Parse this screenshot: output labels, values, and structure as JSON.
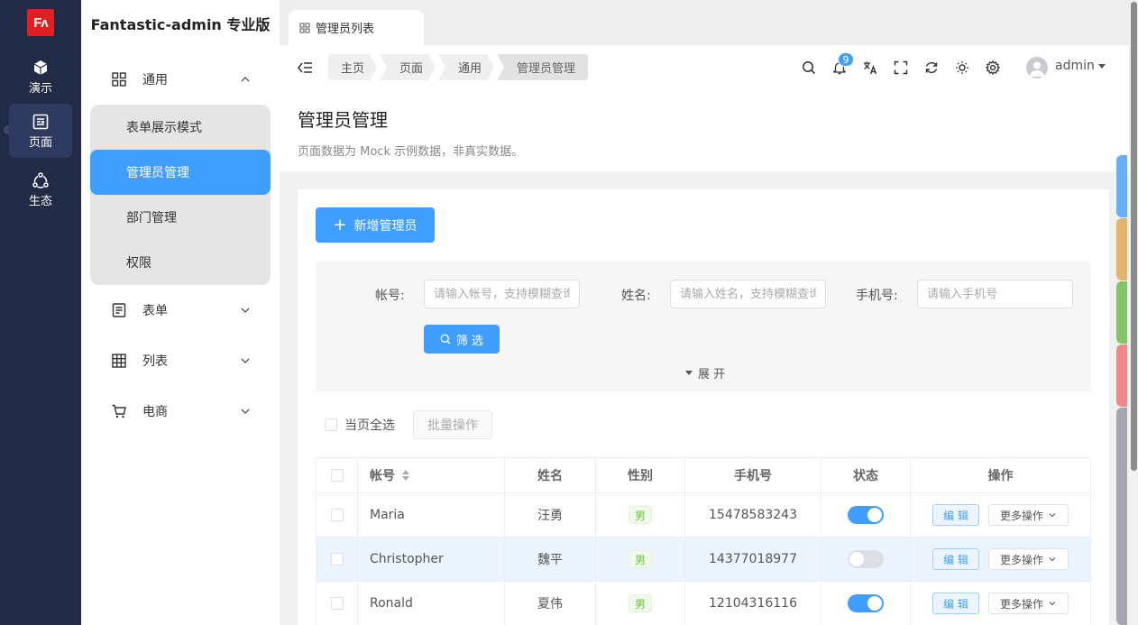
{
  "logo": {
    "text": "Fʌ"
  },
  "main_sidebar": {
    "items": [
      {
        "label": "演示",
        "icon": "cube-icon"
      },
      {
        "label": "页面",
        "icon": "page-icon"
      },
      {
        "label": "生态",
        "icon": "ecosystem-icon"
      }
    ]
  },
  "sub_sidebar": {
    "brand": "Fantastic-admin 专业版",
    "groups": [
      {
        "label": "通用",
        "icon": "grid-icon"
      },
      {
        "label": "表单",
        "icon": "form-icon"
      },
      {
        "label": "列表",
        "icon": "table-icon"
      },
      {
        "label": "电商",
        "icon": "cart-icon"
      }
    ],
    "sub_items": [
      {
        "label": "表单展示模式"
      },
      {
        "label": "管理员管理"
      },
      {
        "label": "部门管理"
      },
      {
        "label": "权限"
      }
    ]
  },
  "tabs": [
    {
      "label": "管理员列表"
    }
  ],
  "breadcrumb": [
    {
      "label": "主页"
    },
    {
      "label": "页面"
    },
    {
      "label": "通用"
    },
    {
      "label": "管理员管理"
    }
  ],
  "toolbar": {
    "notification_count": "9",
    "user_name": "admin"
  },
  "page": {
    "title": "管理员管理",
    "description": "页面数据为 Mock 示例数据，非真实数据。"
  },
  "actions": {
    "add_button": "新增管理员",
    "filter_button": "筛 选",
    "expand": "展 开",
    "select_page": "当页全选",
    "batch_button": "批量操作"
  },
  "search": {
    "fields": [
      {
        "label": "帐号:",
        "placeholder": "请输入帐号，支持模糊查询"
      },
      {
        "label": "姓名:",
        "placeholder": "请输入姓名，支持模糊查询"
      },
      {
        "label": "手机号:",
        "placeholder": "请输入手机号"
      }
    ]
  },
  "table": {
    "headers": [
      "帐号",
      "姓名",
      "性别",
      "手机号",
      "状态",
      "操作"
    ],
    "edit_label": "编 辑",
    "more_label": "更多操作",
    "rows": [
      {
        "account": "Maria",
        "name": "汪勇",
        "gender": "男",
        "phone": "15478583243",
        "status": true
      },
      {
        "account": "Christopher",
        "name": "魏平",
        "gender": "男",
        "phone": "14377018977",
        "status": false
      },
      {
        "account": "Ronald",
        "name": "夏伟",
        "gender": "男",
        "phone": "12104316116",
        "status": true
      }
    ]
  },
  "colors": {
    "primary": "#409eff",
    "sidebar": "#222b45",
    "side_strip": [
      "#6aaef6",
      "#e3b56f",
      "#82c46a",
      "#ee8a8c",
      "#a6a6b2"
    ]
  }
}
